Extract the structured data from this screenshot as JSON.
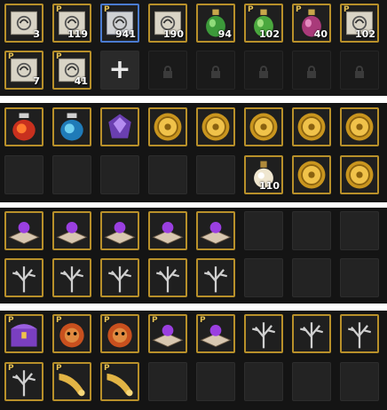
{
  "colors": {
    "gold_border": "#b8902a",
    "blue_border": "#4a7bd0",
    "panel_bg": "#141414",
    "count_text": "#ffffff",
    "premium_mark": "#e6c256"
  },
  "premium_mark": "P",
  "add_button_label": "+",
  "panel1": {
    "items": [
      {
        "icon": "scroll-icon",
        "count": "3",
        "premium": false
      },
      {
        "icon": "scroll-icon",
        "count": "119",
        "premium": true
      },
      {
        "icon": "scroll-icon",
        "count": "941",
        "premium": true
      },
      {
        "icon": "scroll-icon",
        "count": "190",
        "premium": false
      },
      {
        "icon": "green-potion-icon",
        "count": "94",
        "premium": false
      },
      {
        "icon": "green-potion-icon",
        "count": "102",
        "premium": true
      },
      {
        "icon": "pink-potion-icon",
        "count": "40",
        "premium": true
      },
      {
        "icon": "scroll-icon",
        "count": "102",
        "premium": true
      },
      {
        "icon": "scroll-icon",
        "count": "7",
        "premium": true
      },
      {
        "icon": "scroll-icon",
        "count": "41",
        "premium": true
      }
    ],
    "locked_slots": 5
  },
  "panel2": {
    "items": [
      {
        "icon": "red-crystal-jar-icon",
        "count": ""
      },
      {
        "icon": "blue-crystal-jar-icon",
        "count": ""
      },
      {
        "icon": "purple-gem-icon",
        "count": ""
      },
      {
        "icon": "gold-coin-icon",
        "count": ""
      },
      {
        "icon": "gold-coin-icon",
        "count": ""
      },
      {
        "icon": "gold-coin-icon",
        "count": ""
      },
      {
        "icon": "gold-coin-icon",
        "count": ""
      },
      {
        "icon": "gold-coin-icon",
        "count": ""
      },
      {
        "icon": "elixir-bottle-icon",
        "count": "110"
      },
      {
        "icon": "gold-coin-icon",
        "count": ""
      },
      {
        "icon": "gold-coin-icon",
        "count": ""
      }
    ]
  },
  "panel3": {
    "rows": [
      [
        "magic-tome-icon",
        "magic-tome-icon",
        "magic-tome-icon",
        "magic-tome-icon",
        "magic-tome-icon"
      ],
      [
        "silver-tree-icon",
        "silver-tree-icon",
        "silver-tree-icon",
        "silver-tree-icon",
        "silver-tree-icon"
      ]
    ]
  },
  "panel4": {
    "row1": [
      "treasure-chest-icon",
      "lion-mask-icon",
      "lion-mask-icon",
      "magic-tome-icon",
      "magic-tome-icon",
      "silver-tree-icon",
      "silver-tree-icon",
      "silver-tree-icon"
    ],
    "row2": [
      "silver-tree-icon",
      "golden-horn-icon",
      "golden-horn-icon"
    ]
  }
}
